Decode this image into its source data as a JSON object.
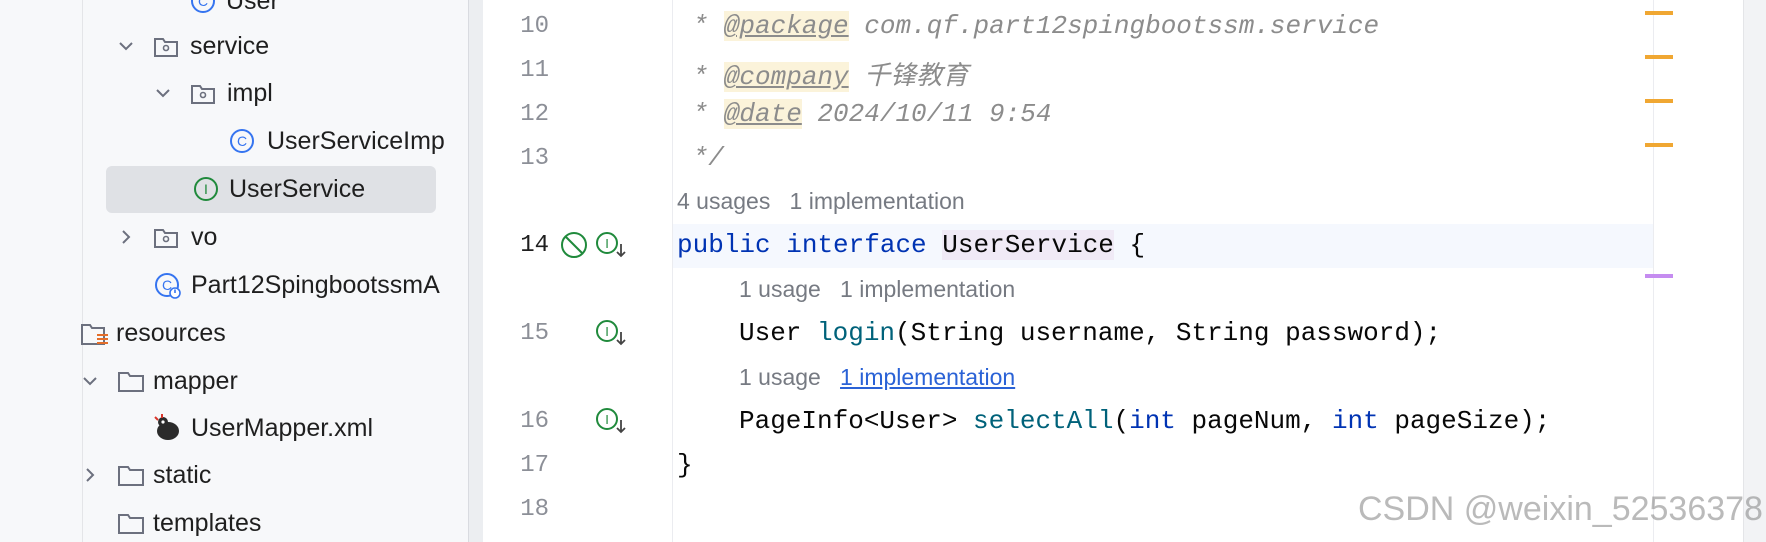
{
  "tree": {
    "items": [
      {
        "label": "User",
        "icon": "class-icon"
      },
      {
        "label": "service",
        "icon": "package-folder-icon"
      },
      {
        "label": "impl",
        "icon": "package-folder-icon"
      },
      {
        "label": "UserServiceImp",
        "icon": "class-icon"
      },
      {
        "label": "UserService",
        "icon": "interface-icon"
      },
      {
        "label": "vo",
        "icon": "package-folder-icon"
      },
      {
        "label": "Part12SpingbootssmA",
        "icon": "spring-boot-class-icon"
      },
      {
        "label": "resources",
        "icon": "resources-folder-icon"
      },
      {
        "label": "mapper",
        "icon": "folder-icon"
      },
      {
        "label": "UserMapper.xml",
        "icon": "mybatis-xml-icon"
      },
      {
        "label": "static",
        "icon": "folder-icon"
      },
      {
        "label": "templates",
        "icon": "folder-icon"
      }
    ]
  },
  "editor": {
    "line_numbers": [
      "10",
      "11",
      "12",
      "13",
      "14",
      "15",
      "16",
      "17",
      "18"
    ],
    "lines": {
      "l10": {
        "prefix": " * ",
        "tag": "@package",
        "rest": " com.qf.part12spingbootssm.service"
      },
      "l11": {
        "prefix": " * ",
        "tag": "@company",
        "rest": " 千锋教育"
      },
      "l12": {
        "prefix": " * ",
        "tag": "@date",
        "rest": " 2024/10/11 9:54"
      },
      "l13": {
        "text": " */"
      },
      "l14": {
        "kw1": "public",
        "kw2": "interface",
        "name": "UserService",
        "brace": " {"
      },
      "l15": {
        "type": "User ",
        "method": "login",
        "params": "(String username, String password);"
      },
      "l16": {
        "type": "PageInfo<User> ",
        "method": "selectAll",
        "p1": "(",
        "kw_int1": "int",
        "p2": " pageNum, ",
        "kw_int2": "int",
        "p3": " pageSize);"
      },
      "l17": {
        "text": "}"
      }
    },
    "hints": {
      "interface": {
        "usages": "4 usages",
        "impl": "1 implementation"
      },
      "login": {
        "usages": "1 usage",
        "impl": "1 implementation"
      },
      "selectAll": {
        "usages": "1 usage",
        "impl": "1 implementation"
      }
    }
  },
  "watermark": "CSDN @weixin_52536378",
  "colors": {
    "keyword": "#0033b3",
    "method": "#00627a",
    "comment": "#8c8c8c",
    "marker_warning": "#f0a732",
    "marker_info": "#c58cf0"
  }
}
